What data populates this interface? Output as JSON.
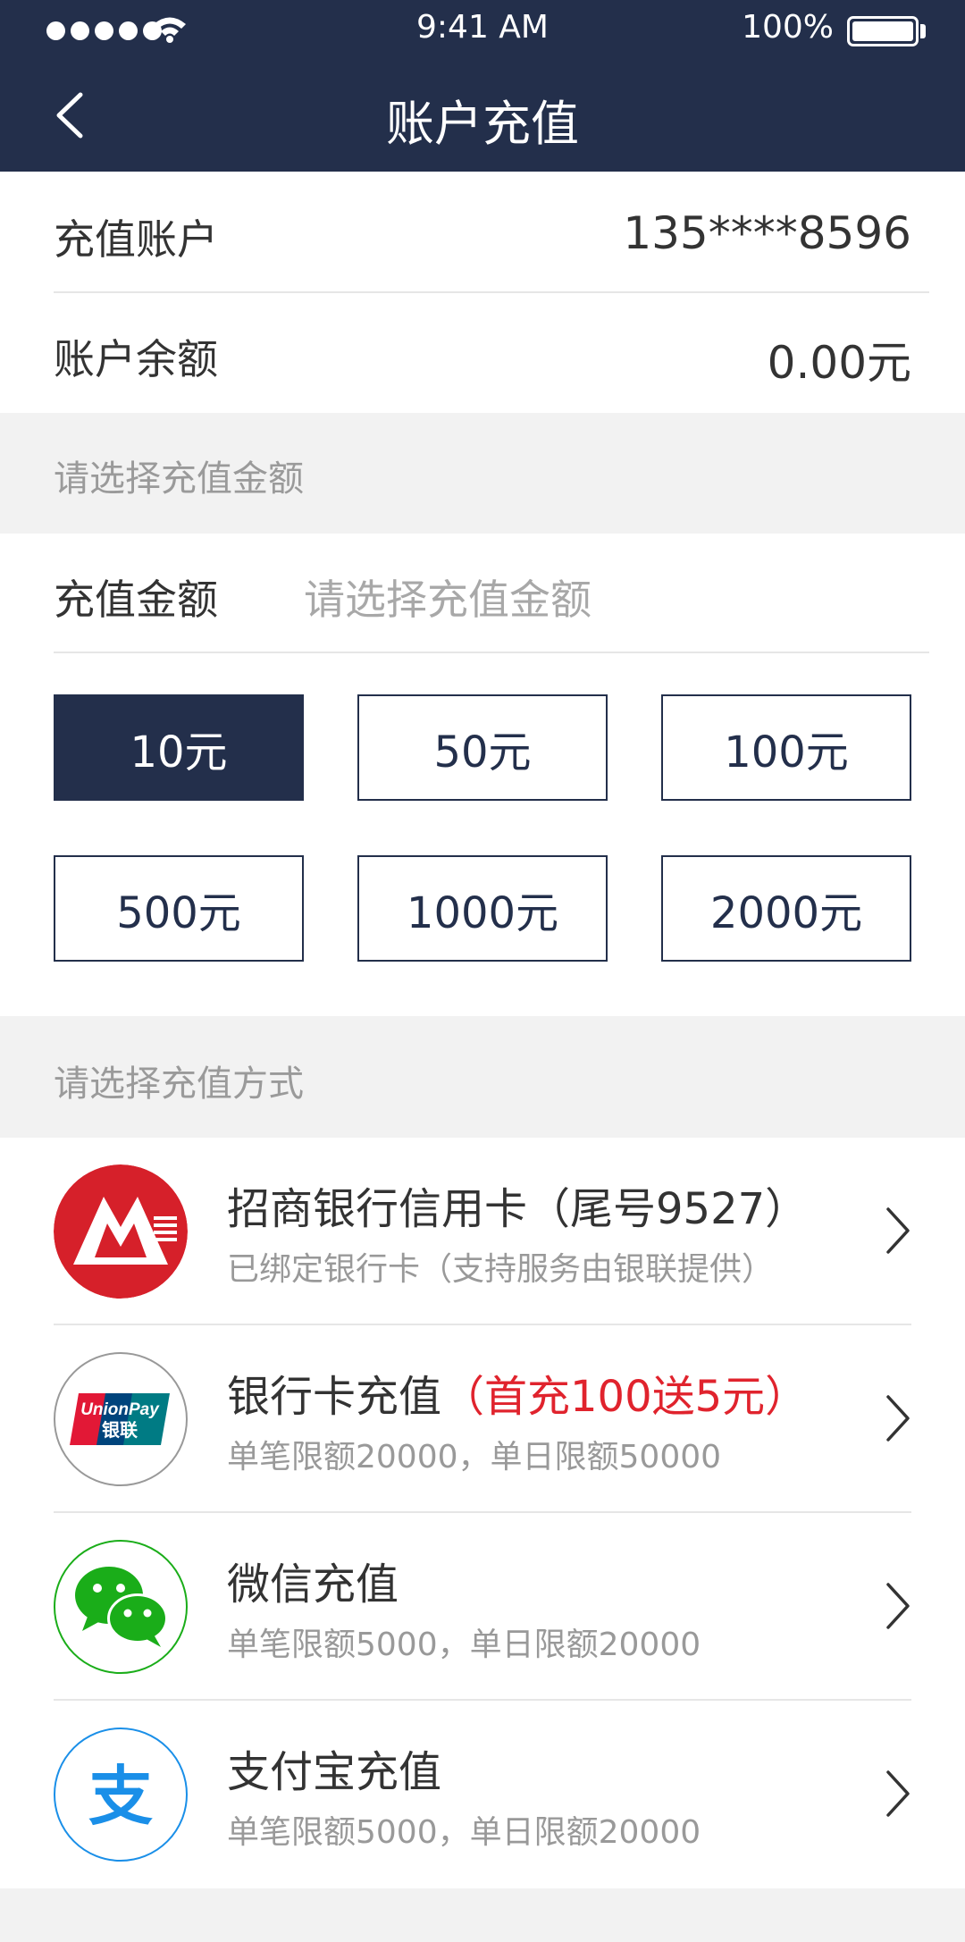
{
  "status_bar": {
    "time": "9:41 AM",
    "battery": "100%"
  },
  "nav": {
    "title": "账户充值"
  },
  "account": {
    "recharge_account_label": "充值账户",
    "recharge_account_value": "135****8596",
    "balance_label": "账户余额",
    "balance_value": "0.00元"
  },
  "amount_section": {
    "header": "请选择充值金额",
    "field_label": "充值金额",
    "field_placeholder": "请选择充值金额",
    "options": [
      "10元",
      "50元",
      "100元",
      "500元",
      "1000元",
      "2000元"
    ],
    "selected": "10元"
  },
  "payment_section": {
    "header": "请选择充值方式",
    "methods": [
      {
        "title": "招商银行信用卡（尾号9527）",
        "promo": "",
        "subtitle": "已绑定银行卡（支持服务由银联提供）",
        "icon": "cmb-bank-icon"
      },
      {
        "title": "银行卡充值",
        "promo": "（首充100送5元）",
        "subtitle": "单笔限额20000，单日限额50000",
        "icon": "unionpay-icon",
        "icon_text": "UnionPay银联"
      },
      {
        "title": "微信充值",
        "promo": "",
        "subtitle": "单笔限额5000，单日限额20000",
        "icon": "wechat-icon"
      },
      {
        "title": "支付宝充值",
        "promo": "",
        "subtitle": "单笔限额5000，单日限额20000",
        "icon": "alipay-icon",
        "icon_text": "支"
      }
    ]
  },
  "colors": {
    "navy": "#232f4b",
    "promo_red": "#e0232d",
    "wechat_green": "#1aad19",
    "alipay_blue": "#1a8fe8",
    "cmb_red": "#d6202a"
  }
}
